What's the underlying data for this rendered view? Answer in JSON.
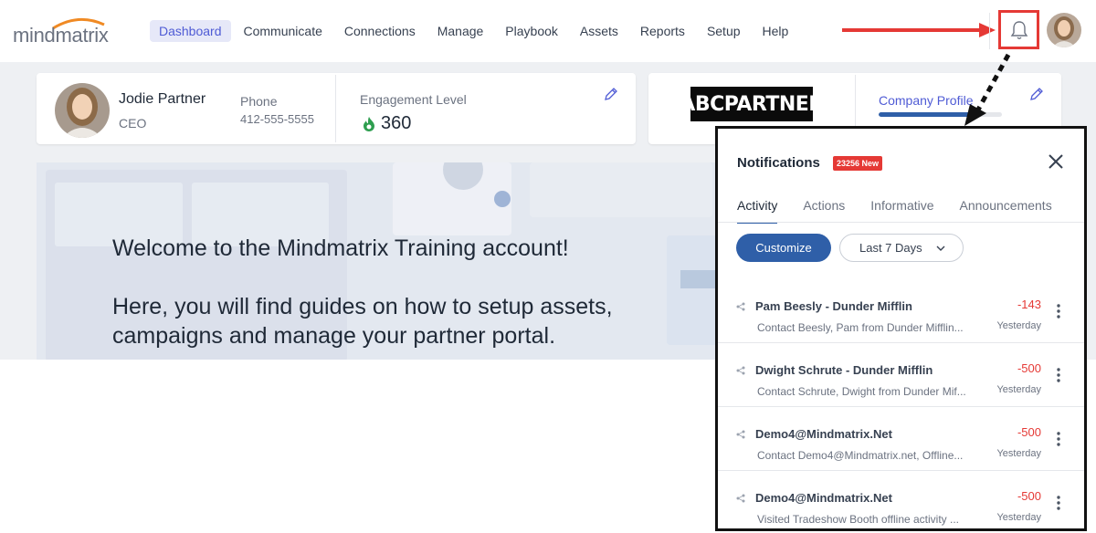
{
  "brand": {
    "name": "mindmatrix"
  },
  "nav": {
    "items": [
      {
        "label": "Dashboard",
        "active": true
      },
      {
        "label": "Communicate"
      },
      {
        "label": "Connections"
      },
      {
        "label": "Manage"
      },
      {
        "label": "Playbook"
      },
      {
        "label": "Assets"
      },
      {
        "label": "Reports"
      },
      {
        "label": "Setup"
      },
      {
        "label": "Help"
      }
    ]
  },
  "header": {
    "bell_icon": "bell-icon",
    "annotation_color": "#e53935"
  },
  "profile": {
    "name": "Jodie Partner",
    "role": "CEO",
    "phone_label": "Phone",
    "phone": "412-555-5555",
    "engagement_label": "Engagement Level",
    "engagement_value": "360"
  },
  "company": {
    "logo_text": "ABCPARTNER",
    "profile_label": "Company Profile",
    "profile_progress": 0.77
  },
  "hero": {
    "line1": "Welcome to the Mindmatrix Training account!",
    "line2": "Here, you will find guides on how to setup assets, campaigns and manage your partner portal."
  },
  "notifications": {
    "title": "Notifications",
    "new_badge": "23256 New",
    "tabs": [
      {
        "label": "Activity",
        "active": true
      },
      {
        "label": "Actions"
      },
      {
        "label": "Informative"
      },
      {
        "label": "Announcements"
      }
    ],
    "customize_label": "Customize",
    "range_label": "Last 7 Days",
    "items": [
      {
        "title": "Pam Beesly - Dunder Mifflin",
        "desc": "Contact Beesly, Pam from Dunder Mifflin...",
        "score": "-143",
        "time": "Yesterday"
      },
      {
        "title": "Dwight Schrute - Dunder Mifflin",
        "desc": "Contact Schrute, Dwight from Dunder Mif...",
        "score": "-500",
        "time": "Yesterday"
      },
      {
        "title": "Demo4@Mindmatrix.Net",
        "desc": "Contact Demo4@Mindmatrix.net, Offline...",
        "score": "-500",
        "time": "Yesterday"
      },
      {
        "title": "Demo4@Mindmatrix.Net",
        "desc": "Visited Tradeshow Booth offline activity ...",
        "score": "-500",
        "time": "Yesterday"
      }
    ]
  },
  "colors": {
    "accent": "#4f5bd5",
    "primary": "#2f5fa8",
    "negative": "#e53935",
    "engagement": "#2e9e4f"
  }
}
